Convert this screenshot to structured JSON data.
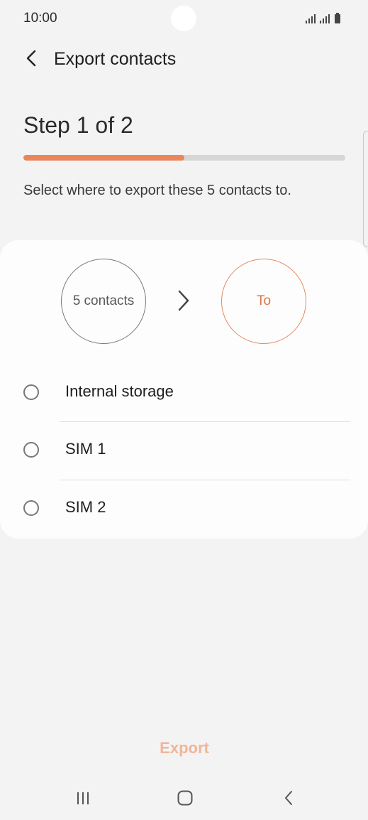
{
  "status_bar": {
    "time": "10:00"
  },
  "app_bar": {
    "title": "Export contacts",
    "back_icon": "chevron-left-icon"
  },
  "step": {
    "title": "Step 1 of 2",
    "progress": 0.5
  },
  "instruction": "Select where to export these 5 contacts to.",
  "flow": {
    "source_label": "5 contacts",
    "target_label": "To"
  },
  "options": [
    {
      "label": "Internal storage",
      "selected": false
    },
    {
      "label": "SIM 1",
      "selected": false
    },
    {
      "label": "SIM 2",
      "selected": false
    }
  ],
  "actions": {
    "export_label": "Export"
  },
  "colors": {
    "accent": "#e9875b",
    "export_disabled": "#f0b69a"
  },
  "nav": {
    "recents_icon": "recent-apps-icon",
    "home_icon": "home-icon",
    "back_icon": "back-icon"
  }
}
